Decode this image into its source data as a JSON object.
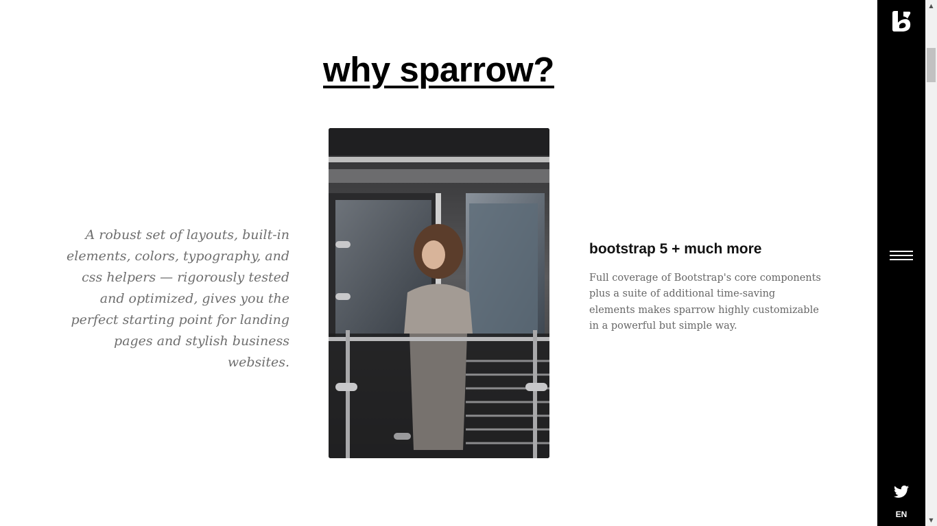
{
  "heading": {
    "title": "why sparrow?"
  },
  "intro": {
    "lead": "A robust set of layouts, built-in elements, colors, typography, and css helpers — rigorously tested and optimized, gives you the perfect starting point for landing pages and stylish business websites."
  },
  "feature": {
    "title": "bootstrap 5 + much more",
    "text": "Full coverage of Bootstrap's core components plus a suite of additional time-saving elements makes sparrow highly customizable in a powerful but simple way."
  },
  "sidebar": {
    "logo_icon": "sparrow-logo-icon",
    "menu_icon": "hamburger-menu-icon",
    "social_icon": "twitter-icon",
    "language": "EN"
  },
  "colors": {
    "sidebar_bg": "#000000",
    "page_bg": "#ffffff",
    "lead_text": "#6e6e6e"
  }
}
